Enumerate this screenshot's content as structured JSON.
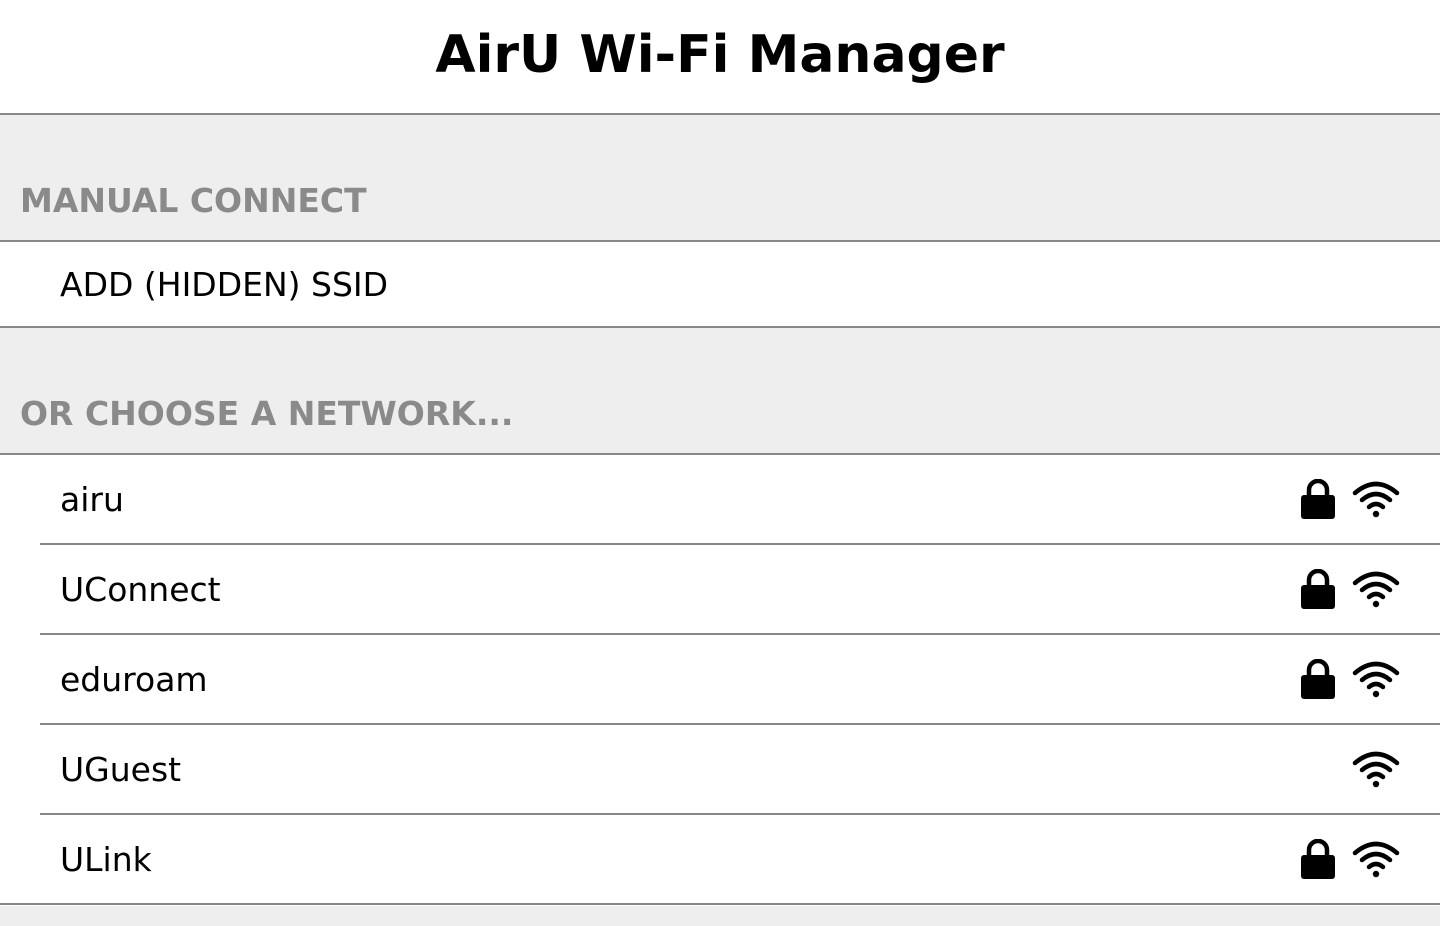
{
  "app": {
    "title": "AirU Wi-Fi Manager"
  },
  "manual": {
    "section_label": "MANUAL CONNECT",
    "add_hidden_label": "ADD (HIDDEN) SSID"
  },
  "networks_section": {
    "section_label": "OR CHOOSE A NETWORK..."
  },
  "networks": [
    {
      "ssid": "airu",
      "secured": true,
      "signal_icon": "wifi-icon"
    },
    {
      "ssid": "UConnect",
      "secured": true,
      "signal_icon": "wifi-icon"
    },
    {
      "ssid": "eduroam",
      "secured": true,
      "signal_icon": "wifi-icon"
    },
    {
      "ssid": "UGuest",
      "secured": false,
      "signal_icon": "wifi-icon"
    },
    {
      "ssid": "ULink",
      "secured": true,
      "signal_icon": "wifi-icon"
    }
  ],
  "colors": {
    "section_bg": "#eeeeee",
    "section_text": "#8a8a8a",
    "divider": "#888888"
  }
}
